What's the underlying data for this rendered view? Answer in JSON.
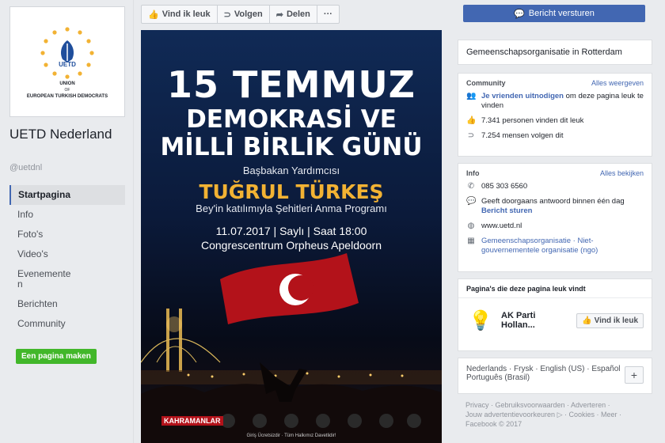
{
  "page": {
    "name": "UETD Nederland",
    "handle": "@uetdnl",
    "logo": {
      "abbr": "UETD",
      "line1": "UNION",
      "line2": "OF",
      "line3": "EUROPEAN TURKISH DEMOCRATS"
    }
  },
  "nav": {
    "items": [
      "Startpagina",
      "Info",
      "Foto's",
      "Video's",
      "Evenemente\nn",
      "Berichten",
      "Community"
    ],
    "create_page": "Een pagina maken"
  },
  "toolbar": {
    "like": "Vind ik leuk",
    "follow": "Volgen",
    "share": "Delen",
    "more": "···"
  },
  "poster": {
    "title_line1": "15 TEMMUZ",
    "title_line2": "DEMOKRASİ VE",
    "title_line3": "MİLLİ BİRLİK GÜNÜ",
    "subtitle": "Başbakan Yardımcısı",
    "speaker": "TUĞRUL TÜRKEŞ",
    "program": "Bey'in katılımıyla Şehitleri Anma Programı",
    "date_line": "11.07.2017 | Saylı | Saat 18:00",
    "venue": "Congrescentrum Orpheus Apeldoorn",
    "badge": "KAHRAMANLAR",
    "footer": "Giriş Ücretsizdir · Tüm Halkımız Davetlidir!"
  },
  "sidebar": {
    "send_message": "Bericht versturen",
    "category": "Gemeenschapsorganisatie in Rotterdam",
    "community": {
      "title": "Community",
      "see_all": "Alles weergeven",
      "invite_link": "Je vrienden uitnodigen",
      "invite_rest": "om deze pagina leuk te vinden",
      "likes": "7.341 personen vinden dit leuk",
      "follows": "7.254 mensen volgen dit"
    },
    "info": {
      "title": "Info",
      "see_all": "Alles bekijken",
      "phone": "085 303 6560",
      "response": "Geeft doorgaans antwoord binnen één dag",
      "send_link": "Bericht sturen",
      "website": "www.uetd.nl",
      "category_link": "Gemeenschapsorganisatie · Niet-gouvernementele organisatie (ngo)"
    },
    "liked_pages": {
      "title": "Pagina's die deze pagina leuk vindt",
      "page_name": "AK Parti Hollan...",
      "like_button": "Vind ik leuk"
    },
    "languages": {
      "line1": "Nederlands · Frysk · English (US) · Español",
      "line2": "Português (Brasil)",
      "add": "+"
    },
    "footer": {
      "line1": "Privacy · Gebruiksvoorwaarden · Adverteren ·",
      "line2": "Jouw advertentievoorkeuren ▷ · Cookies · Meer ·",
      "line3": "Facebook © 2017"
    }
  },
  "colors": {
    "fb_blue": "#4267b2",
    "green": "#42b72a",
    "poster_gold": "#f2b233"
  }
}
